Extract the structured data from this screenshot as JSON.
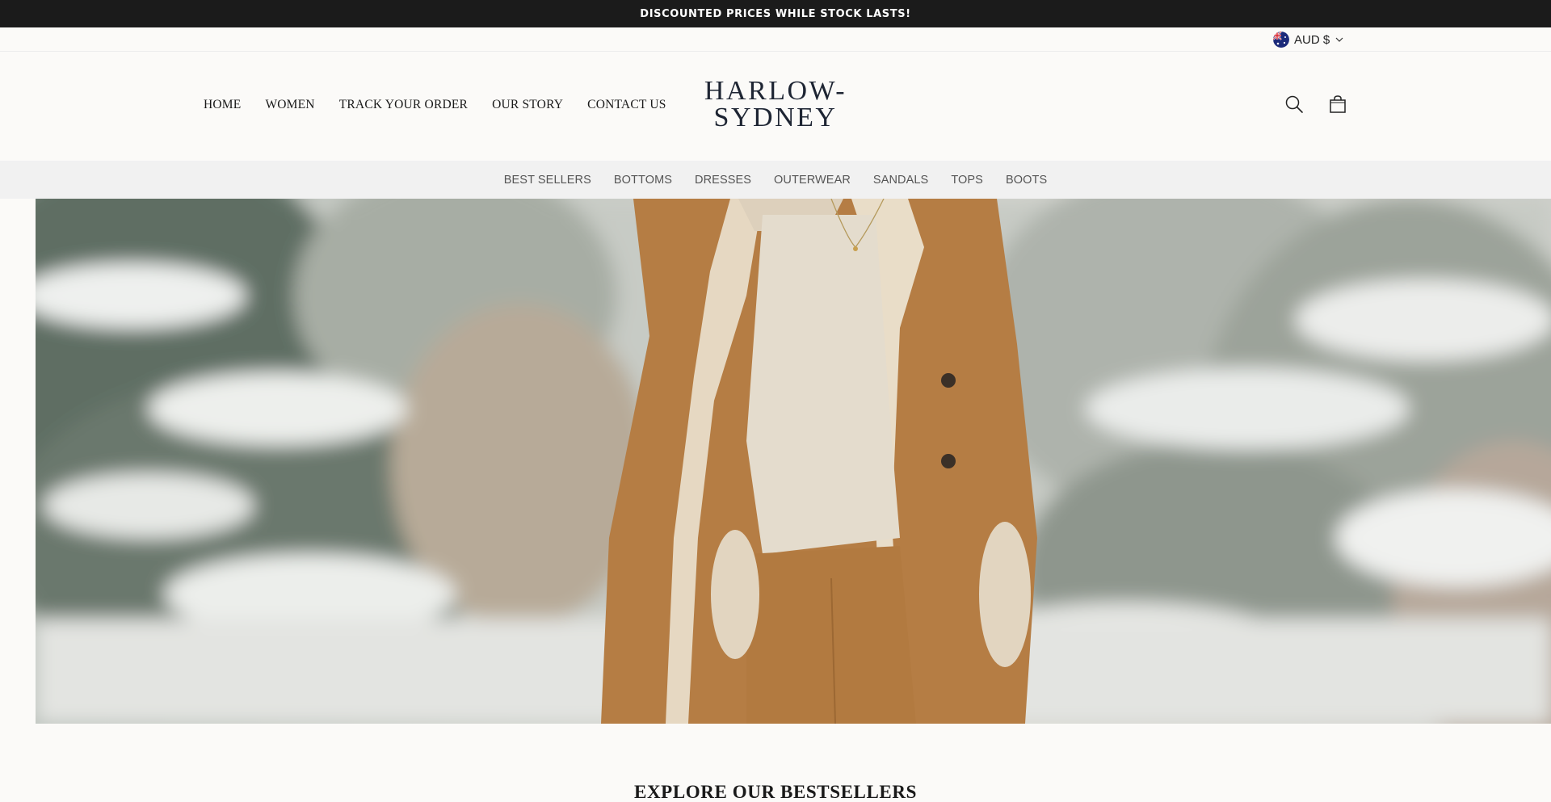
{
  "announcement": {
    "text": "DISCOUNTED PRICES WHILE STOCK LASTS!"
  },
  "currency": {
    "label": "AUD $",
    "flag_icon": "australia-flag-icon"
  },
  "nav": {
    "items": [
      {
        "label": "HOME"
      },
      {
        "label": "WOMEN"
      },
      {
        "label": "TRACK YOUR ORDER"
      },
      {
        "label": "OUR STORY"
      },
      {
        "label": "CONTACT US"
      }
    ]
  },
  "logo": {
    "line1": "HARLOW-",
    "line2": "SYDNEY"
  },
  "header_icons": {
    "search": "search-icon",
    "cart": "shopping-bag-icon"
  },
  "categories": {
    "items": [
      {
        "label": "BEST SELLERS"
      },
      {
        "label": "BOTTOMS"
      },
      {
        "label": "DRESSES"
      },
      {
        "label": "OUTERWEAR"
      },
      {
        "label": "SANDALS"
      },
      {
        "label": "TOPS"
      },
      {
        "label": "BOOTS"
      }
    ]
  },
  "section": {
    "title": "EXPLORE OUR BESTSELLERS"
  },
  "colors": {
    "announcement_bg": "#1b1b1b",
    "page_bg": "#fbfaf8",
    "category_bar_bg": "#f1f1f1",
    "logo_color": "#1e2533",
    "coat_camel": "#b57d44"
  }
}
